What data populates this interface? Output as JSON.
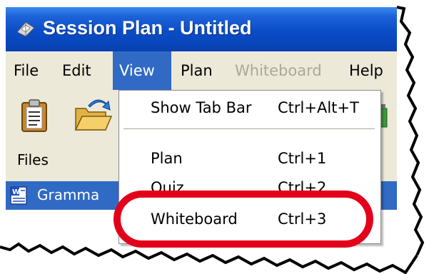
{
  "window": {
    "title": "Session Plan - Untitled",
    "colors": {
      "titlebar": "#0a4cc8",
      "menu_highlight": "#316ac5",
      "callout": "#e2001a"
    }
  },
  "menubar": {
    "items": [
      {
        "label": "File",
        "state": "normal"
      },
      {
        "label": "Edit",
        "state": "normal"
      },
      {
        "label": "View",
        "state": "open"
      },
      {
        "label": "Plan",
        "state": "normal"
      },
      {
        "label": "Whiteboard",
        "state": "disabled"
      },
      {
        "label": "Help",
        "state": "normal"
      }
    ]
  },
  "toolbar": {
    "buttons": [
      {
        "icon": "clipboard-icon"
      },
      {
        "icon": "open-folder-icon"
      }
    ]
  },
  "files_pane": {
    "label": "Files",
    "selected_item": {
      "icon": "word-document-icon",
      "label": "Gramma"
    }
  },
  "view_menu": {
    "items": [
      {
        "label": "Show Tab Bar",
        "shortcut": "Ctrl+Alt+T"
      },
      {
        "label": "Plan",
        "shortcut": "Ctrl+1"
      },
      {
        "label": "Quiz",
        "shortcut": "Ctrl+2"
      },
      {
        "label": "Whiteboard",
        "shortcut": "Ctrl+3",
        "highlighted_by_callout": true
      }
    ]
  }
}
